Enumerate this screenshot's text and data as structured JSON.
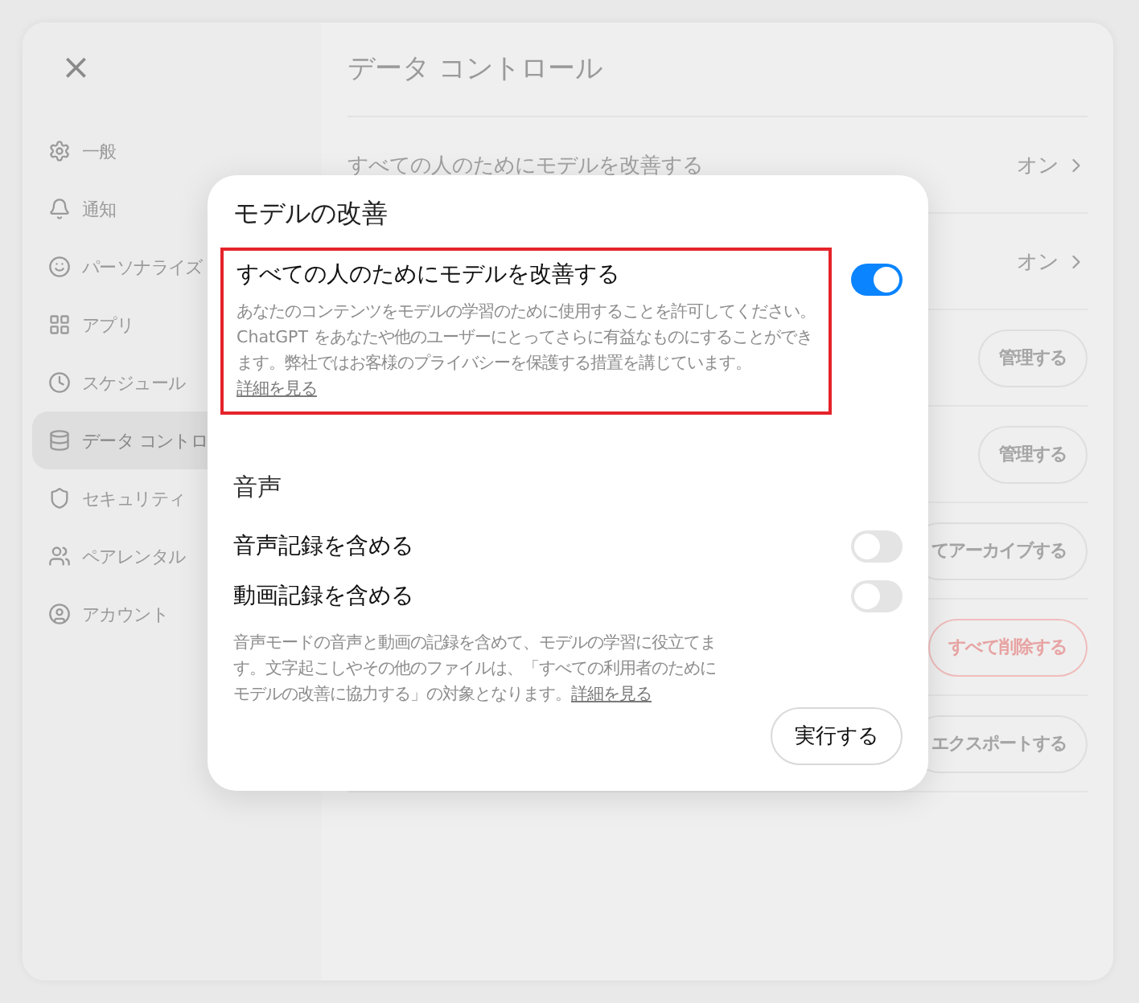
{
  "sidebar": {
    "close": "×",
    "items": [
      {
        "label": "一般",
        "selected": false
      },
      {
        "label": "通知",
        "selected": false
      },
      {
        "label": "パーソナライズ",
        "selected": false
      },
      {
        "label": "アプリ",
        "selected": false
      },
      {
        "label": "スケジュール",
        "selected": false
      },
      {
        "label": "データ コントロ",
        "selected": true
      },
      {
        "label": "セキュリティ",
        "selected": false
      },
      {
        "label": "ペアレンタル",
        "selected": false
      },
      {
        "label": "アカウント",
        "selected": false
      }
    ]
  },
  "main": {
    "title": "データ コントロール",
    "rows": [
      {
        "kind": "value",
        "label": "すべての人のためにモデルを改善する",
        "value": "オン"
      },
      {
        "kind": "value",
        "value": "オン"
      },
      {
        "kind": "button",
        "button": "管理する",
        "danger": false
      },
      {
        "kind": "button",
        "button": "管理する",
        "danger": false
      },
      {
        "kind": "button",
        "button": "てアーカイブする",
        "danger": false
      },
      {
        "kind": "button",
        "button": "すべて削除する",
        "danger": true
      },
      {
        "kind": "button",
        "button": "エクスポートする",
        "danger": false
      }
    ]
  },
  "dialog": {
    "title": "モデルの改善",
    "improve": {
      "label": "すべての人のためにモデルを改善する",
      "description": "あなたのコンテンツをモデルの学習のために使用することを許可してください。ChatGPT をあなたや他のユーザーにとってさらに有益なものにすることができます。弊社ではお客様のプライバシーを保護する措置を講じています。",
      "link": "詳細を見る",
      "on": true,
      "highlighted": true
    },
    "voice": {
      "heading": "音声",
      "toggles": [
        {
          "label": "音声記録を含める",
          "on": false
        },
        {
          "label": "動画記録を含める",
          "on": false
        }
      ],
      "description": "音声モードの音声と動画の記録を含めて、モデルの学習に役立てます。文字起こしやその他のファイルは、「すべての利用者のためにモデルの改善に協力する」の対象となります。",
      "link": "詳細を見る"
    },
    "button": "実行する"
  }
}
